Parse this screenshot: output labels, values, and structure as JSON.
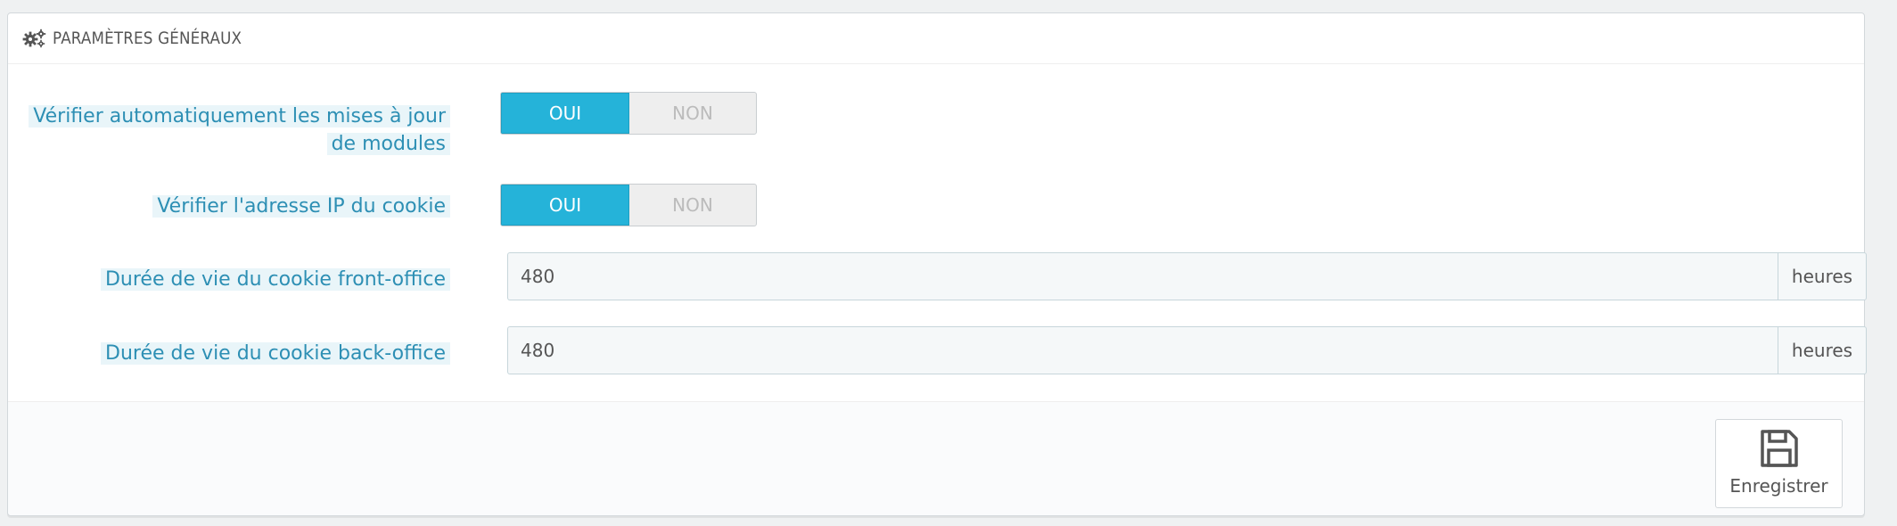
{
  "panel": {
    "title": "PARAMÈTRES GÉNÉRAUX",
    "icon": "cogs-icon"
  },
  "fields": {
    "auto_update": {
      "label": "Vérifier automatiquement les mises à jour de modules",
      "label_line1": "Vérifier automatiquement les mises à jour",
      "label_line2": "de modules",
      "yes": "OUI",
      "no": "NON",
      "selected": "OUI"
    },
    "cookie_ip": {
      "label": "Vérifier l'adresse IP du cookie",
      "yes": "OUI",
      "no": "NON",
      "selected": "OUI"
    },
    "front_lifetime": {
      "label": "Durée de vie du cookie front-office",
      "value": "480",
      "unit": "heures"
    },
    "back_lifetime": {
      "label": "Durée de vie du cookie back-office",
      "value": "480",
      "unit": "heures"
    }
  },
  "footer": {
    "save_label": "Enregistrer",
    "save_icon": "floppy-disk-icon"
  },
  "colors": {
    "accent": "#25b3d9",
    "label": "#2d8fb4",
    "label_highlight": "#e9f5f9"
  }
}
